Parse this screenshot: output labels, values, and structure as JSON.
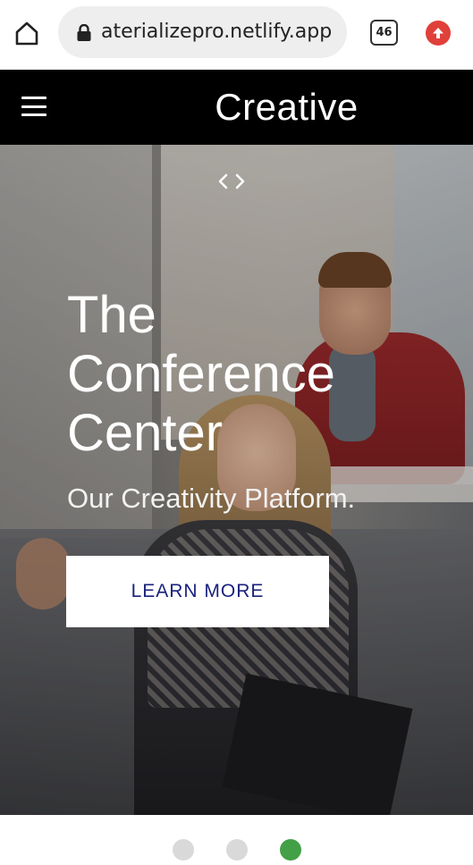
{
  "browser": {
    "url": "aterializepro.netlify.app",
    "tab_count": "46",
    "icons": [
      "home-icon",
      "lock-icon",
      "tabs-icon",
      "update-icon"
    ]
  },
  "site": {
    "brand": "Creative",
    "menu_icon": "hamburger-menu-icon"
  },
  "hero": {
    "code_icon": "code-icon",
    "title_lines": [
      "The",
      "Conference",
      "Center"
    ],
    "subtitle": "Our Creativity Platform.",
    "cta_label": "LEARN MORE",
    "cta_color": "#1a237e"
  },
  "carousel": {
    "slides": 3,
    "active_index": 2,
    "active_color": "#43a047",
    "inactive_color": "#d9d9d9"
  }
}
